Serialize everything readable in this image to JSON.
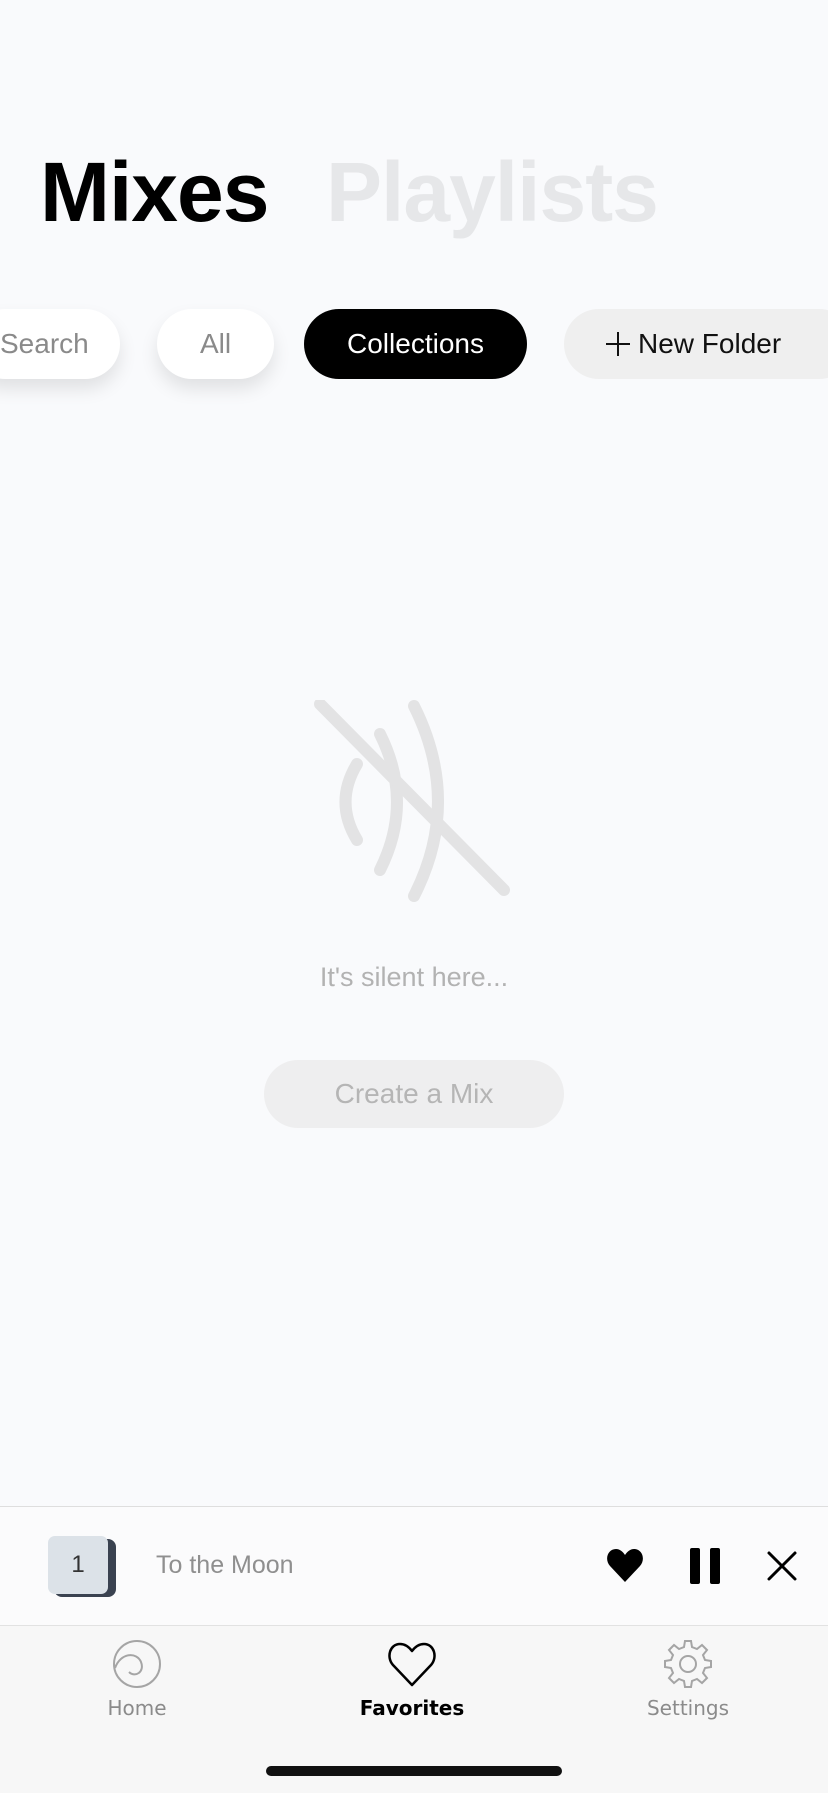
{
  "header": {
    "tabs": [
      {
        "label": "Mixes",
        "active": true
      },
      {
        "label": "Playlists",
        "active": false
      }
    ]
  },
  "filters": {
    "search": "Search",
    "all": "All",
    "collections": "Collections",
    "new_folder": "New Folder",
    "selected": "Collections"
  },
  "empty_state": {
    "icon": "sound-waves-muted-icon",
    "message": "It's silent here...",
    "button": "Create a Mix"
  },
  "now_playing": {
    "thumbnail_number": "1",
    "title": "To the Moon",
    "controls": [
      "heart-icon",
      "pause-icon",
      "close-icon"
    ]
  },
  "tabbar": {
    "items": [
      {
        "label": "Home",
        "icon": "wave-logo-icon",
        "active": false
      },
      {
        "label": "Favorites",
        "icon": "heart-outline-icon",
        "active": true
      },
      {
        "label": "Settings",
        "icon": "gear-icon",
        "active": false
      }
    ]
  },
  "colors": {
    "background": "#f9fafc",
    "active_chip": "#000000",
    "inactive_header": "#e6e7e9",
    "muted_text": "#b2b2b2"
  }
}
